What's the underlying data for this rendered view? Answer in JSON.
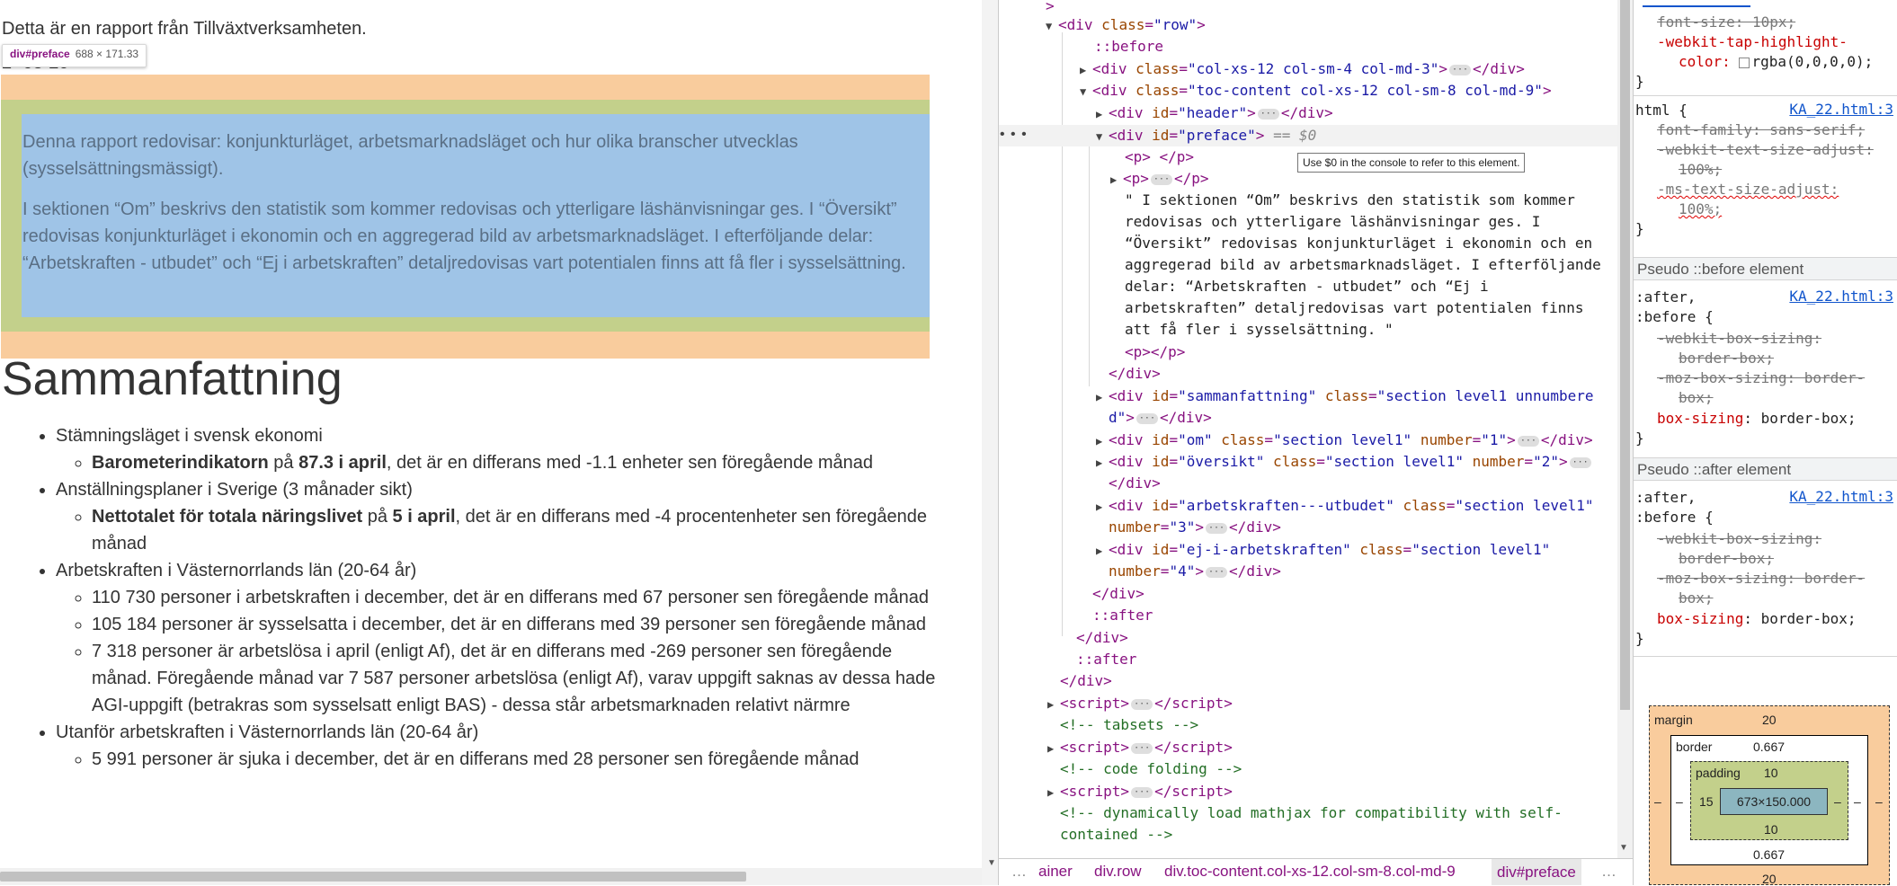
{
  "page": {
    "intro": "Detta är en rapport från Tillväxtverksamheten.",
    "date_partial": "2  -03-20",
    "tooltip": {
      "selector": "div#preface",
      "size": "688 × 171.33"
    },
    "preface_p1": "Denna rapport redovisar: konjunkturläget, arbetsmarknadsläget och hur olika branscher utvecklas (sysselsättningsmässigt).",
    "preface_p2": "I sektionen “Om” beskrivs den statistik som kommer redovisas och ytterligare läshänvisningar ges. I “Översikt” redovisas konjunkturläget i ekonomin och en aggregerad bild av arbetsmarknadsläget. I efterföljande delar: “Arbetskraften - utbudet” och “Ej i arbetskraften” detaljredovisas vart potentialen finns att få fler i sysselsättning.",
    "heading": "Sammanfattning",
    "summary": {
      "item1": "Stämningsläget i svensk ekonomi",
      "item1_sub_bold1": "Barometerindikatorn",
      "item1_sub_mid": " på ",
      "item1_sub_bold2": "87.3 i april",
      "item1_sub_rest": ", det är en differans med -1.1 enheter sen föregående månad",
      "item2": "Anställningsplaner i Sverige (3 månader sikt)",
      "item2_sub_bold1": "Nettotalet för totala näringslivet",
      "item2_sub_mid": " på ",
      "item2_sub_bold2": "5 i april",
      "item2_sub_rest": ", det är en differans med -4 procentenheter sen föregående månad",
      "item3": "Arbetskraften i Västernorrlands län (20-64 år)",
      "item3_sub1": "110 730 personer i arbetskraften i december, det är en differans med 67 personer sen föregående månad",
      "item3_sub2": "105 184 personer är sysselsatta i december, det är en differans med 39 personer sen föregående månad",
      "item3_sub3": "7 318 personer är arbetslösa i april (enligt Af), det är en differans med -269 personer sen föregående månad. Föregående månad var 7 587 personer arbetslösa (enligt Af), varav uppgift saknas av dessa hade AGI-uppgift (betrakras som sysselsatt enligt BAS) - dessa står arbetsmarknaden relativt närmre",
      "item4": "Utanför arbetskraften i Västernorrlands län (20-64 år)",
      "item4_sub1": "5 991 personer är sjuka i december, det är en differans med 28 personer sen föregående månad"
    }
  },
  "elements": {
    "l0": ">",
    "row_tag": "div",
    "row_attr": "class",
    "row_val": "\"row\"",
    "before": "::before",
    "col_attr": "class",
    "col_val": "\"col-xs-12 col-sm-4 col-md-3\"",
    "toc_attr": "class",
    "toc_val": "\"toc-content col-xs-12 col-sm-8 col-md-9\"",
    "header_attr": "id",
    "header_val": "\"header\"",
    "preface_attr": "id",
    "preface_val": "\"preface\"",
    "eq0": "== $0",
    "dollar_tip": "Use $0 in the console to refer to this element.",
    "p_empty": "<p> </p>",
    "p_collapsed": "<p>",
    "text_node_l1": "\" I sektionen “Om” beskrivs den statistik som kommer",
    "text_node_l2": "redovisas och ytterligare läshänvisningar ges. I",
    "text_node_l3": "“Översikt” redovisas konjunkturläget i ekonomin och en",
    "text_node_l4": "aggregerad bild av arbetsmarknadsläget. I efterföljande",
    "text_node_l5": "delar: “Arbetskraften - utbudet” och “Ej i",
    "text_node_l6": "arbetskraften” detaljredovisas vart potentialen finns",
    "text_node_l7": "att få fler i sysselsättning. \"",
    "p_pp": "<p></p>",
    "close_div": "</div>",
    "sam_val": "\"sammanfattning\"",
    "sam_class": "\"section level1 unnumbere",
    "sam_class2": "d\"",
    "om_val": "\"om\"",
    "om_class": "\"section level1\"",
    "om_num": "\"1\"",
    "ov_val": "\"översikt\"",
    "ov_class": "\"section level1\"",
    "ov_num": "\"2\"",
    "ak_val": "\"arbetskraften---utbudet\"",
    "ak_class": "\"section level1\"",
    "ak_num": "\"3\"",
    "ej_val": "\"ej-i-arbetskraften\"",
    "ej_class": "\"section level1\"",
    "ej_num": "\"4\"",
    "after": "::after",
    "c_tabsets": "<!-- tabsets -->",
    "c_codefold": "<!-- code folding -->",
    "c_mathjax1": "<!-- dynamically load mathjax for compatibility with self-",
    "c_mathjax2": "contained -->",
    "dots": "• • •"
  },
  "breadcrumb": {
    "more_left": "…",
    "c1": "ainer",
    "c2": "div.row",
    "c3": "div.toc-content.col-xs-12.col-sm-8.col-md-9",
    "c4": "div#preface",
    "more_right": "…"
  },
  "styles": {
    "top_font_size": "font-size: 10px;",
    "top_tap1": "-webkit-tap-highlight-",
    "top_tap2": "color: ",
    "top_tap_val": "rgba(0,0,0,0);",
    "html_sel": "html {",
    "src": "KA_22.html:3",
    "html_src_text": "KA_22.html:3",
    "ff": "font-family: sans-serif;",
    "wtsa": "-webkit-text-size-adjust:",
    "wtsa_val": "100%;",
    "mtsa": "-ms-text-size-adjust:",
    "mtsa_val": "100%;",
    "pseudo_before": "Pseudo ::before element",
    "pseudo_after": "Pseudo ::after element",
    "sel_after": ":after,",
    "sel_before": ":before {",
    "wbs": "-webkit-box-sizing:",
    "bb": "border-box;",
    "mbs": "-moz-box-sizing: border-",
    "mbs2": "box;",
    "bs": "box-sizing: border-box;",
    "close": "}",
    "box_model": {
      "margin_label": "margin",
      "margin_top": "20",
      "margin_bottom": "20",
      "margin_left": "–",
      "margin_right": "–",
      "border_label": "border",
      "border_top": "0.667",
      "border_bottom": "0.667",
      "border_left": "–",
      "border_right": "–",
      "padding_label": "padding",
      "padding_top": "10",
      "padding_bottom": "10",
      "padding_left": "15",
      "padding_right": "–",
      "content": "673×150.000"
    }
  }
}
